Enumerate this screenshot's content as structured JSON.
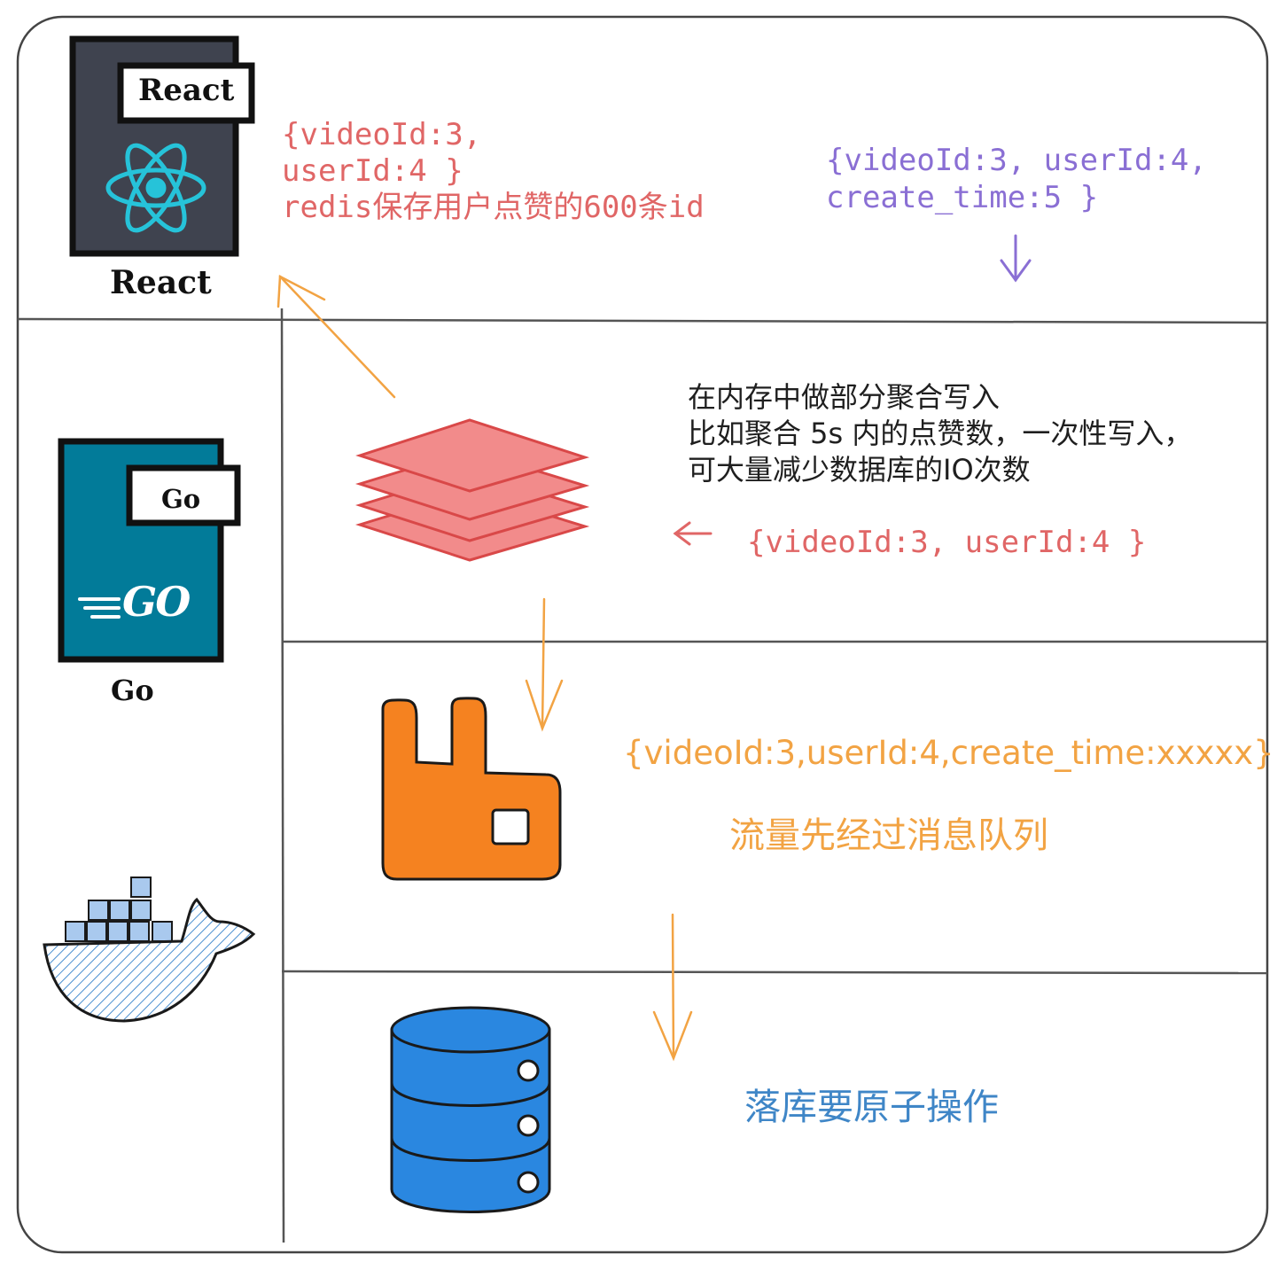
{
  "react_panel": {
    "badge": "React",
    "caption": "React",
    "icon": "react-atom-icon",
    "card_color": "#3f434f",
    "logo_color": "#26c3d9"
  },
  "go_panel": {
    "badge": "Go",
    "caption": "Go",
    "logo_text": "GO",
    "icon": "go-gopher-logo-icon",
    "card_color": "#027b99"
  },
  "docker": {
    "icon": "docker-whale-icon",
    "color": "#4a8fd0"
  },
  "redis_note": {
    "line1": "{videoId:3,",
    "line2": "userId:4 }",
    "line3": "redis保存用户点赞的600条id",
    "color": "#e06666"
  },
  "purple_note": {
    "line1": "{videoId:3, userId:4,",
    "line2": "create_time:5 }",
    "color": "#8a6fd4"
  },
  "aggregation_note": {
    "line1": "在内存中做部分聚合写入",
    "line2": "比如聚合 5s 内的点赞数，一次性写入，",
    "line3": "可大量减少数据库的IO次数"
  },
  "cache_input": {
    "text": "{videoId:3, userId:4 }",
    "icon": "stacked-layers-icon",
    "color": "#f28b8b"
  },
  "queue": {
    "payload": "{videoId:3,userId:4,create_time:xxxxx}",
    "note": "流量先经过消息队列",
    "icon": "rabbitmq-icon",
    "color": "#f58220"
  },
  "database": {
    "note": "落库要原子操作",
    "icon": "database-cylinder-icon",
    "color": "#2a87e0"
  },
  "arrow_colors": {
    "orange": "#f2a343",
    "purple": "#8a6fd4",
    "red": "#e06666"
  }
}
